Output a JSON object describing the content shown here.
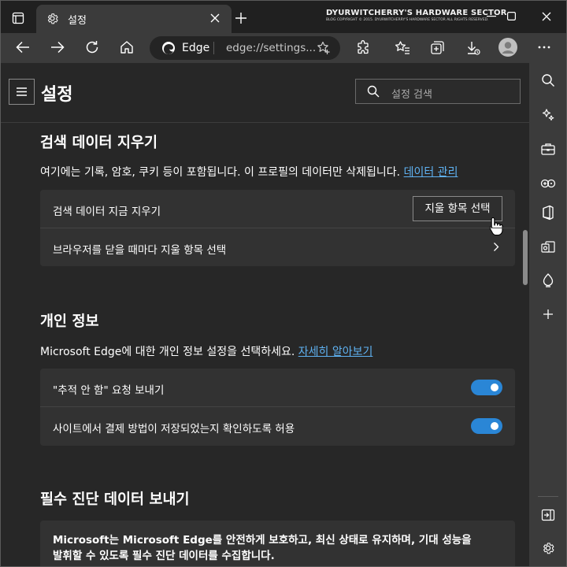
{
  "window": {
    "tab_title": "설정",
    "watermark_title": "DYURWITCHERRY'S HARDWARE SECTOR",
    "watermark_sub": "BLOG COPYRIGHT © 2015. DYURWITCHERRY'S HARDWARE SECTOR ALL RIGHTS RESERVED."
  },
  "addressbar": {
    "site": "Edge",
    "url": "edge://settings..."
  },
  "header": {
    "title": "설정",
    "search_placeholder": "설정 검색"
  },
  "clear_data": {
    "heading": "검색 데이터 지우기",
    "desc": "여기에는 기록, 암호, 쿠키 등이 포함됩니다. 이 프로필의 데이터만 삭제됩니다.",
    "manage_link": "데이터 관리",
    "row1_label": "검색 데이터 지금 지우기",
    "choose_button": "지울 항목 선택",
    "row2_label": "브라우저를 닫을 때마다 지울 항목 선택"
  },
  "privacy": {
    "heading": "개인 정보",
    "desc": "Microsoft Edge에 대한 개인 정보 설정을 선택하세요.",
    "learn_more": "자세히 알아보기",
    "row1_label": "\"추적 안 함\" 요청 보내기",
    "row2_label": "사이트에서 결제 방법이 저장되었는지 확인하도록 허용"
  },
  "diagnostics": {
    "heading": "필수 진단 데이터 보내기",
    "line1": "Microsoft는 Microsoft Edge를 안전하게 보호하고, 최신 상태로 유지하며, 기대 성능을",
    "line2": "발휘할 수 있도록 필수 진단 데이터를 수집합니다."
  },
  "colors": {
    "accent": "#2a86d6",
    "link": "#5fb2f2",
    "background": "#272727",
    "card": "#323232"
  }
}
